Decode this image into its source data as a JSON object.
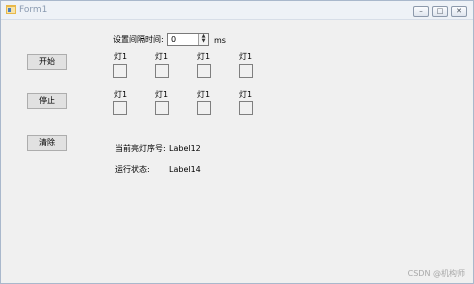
{
  "window": {
    "title": "Form1",
    "minimize": "–",
    "maximize": "□",
    "close": "✕"
  },
  "buttons": {
    "start": "开始",
    "stop": "停止",
    "clear": "清除"
  },
  "interval": {
    "label": "设置间隔时间:",
    "value": "0",
    "unit": "ms"
  },
  "lamps": {
    "row1": [
      "灯1",
      "灯1",
      "灯1",
      "灯1"
    ],
    "row2": [
      "灯1",
      "灯1",
      "灯1",
      "灯1"
    ]
  },
  "status": {
    "current_label": "当前亮灯序号:",
    "current_value": "Label12",
    "run_label": "运行状态:",
    "run_value": "Label14"
  },
  "watermark": "CSDN @机构师",
  "icons": {
    "app": "form-app-icon",
    "spin_up": "spin-up-icon",
    "spin_down": "spin-down-icon"
  }
}
